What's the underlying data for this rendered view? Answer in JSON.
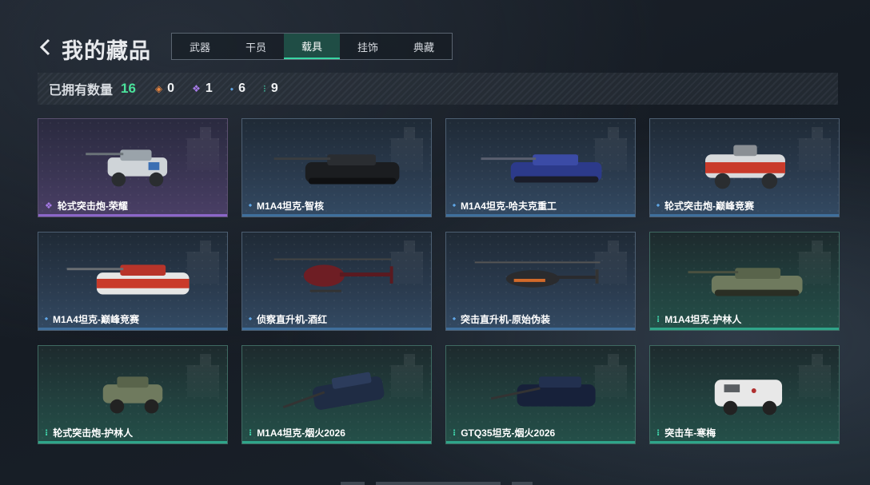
{
  "header": {
    "title": "我的藏品"
  },
  "tabs": [
    {
      "label": "武器",
      "active": false
    },
    {
      "label": "干员",
      "active": false
    },
    {
      "label": "载具",
      "active": true
    },
    {
      "label": "挂饰",
      "active": false
    },
    {
      "label": "典藏",
      "active": false
    }
  ],
  "stats": {
    "owned_label": "已拥有数量",
    "owned_total": "16",
    "orange_count": "0",
    "purple_count": "1",
    "blue_count": "6",
    "green_count": "9"
  },
  "colors": {
    "accent_green": "#4be39c",
    "rarity_orange": "#e9853f",
    "rarity_purple": "#a77be8",
    "rarity_blue": "#5fa6e6",
    "rarity_green": "#3fd0a8"
  },
  "items": [
    {
      "name": "轮式突击炮-荣耀",
      "rarity": "purple"
    },
    {
      "name": "M1A4坦克-智核",
      "rarity": "blue"
    },
    {
      "name": "M1A4坦克-哈夫克重工",
      "rarity": "blue"
    },
    {
      "name": "轮式突击炮-巅峰竞赛",
      "rarity": "blue"
    },
    {
      "name": "M1A4坦克-巅峰竞赛",
      "rarity": "blue"
    },
    {
      "name": "侦察直升机-酒红",
      "rarity": "blue"
    },
    {
      "name": "突击直升机-原始伪装",
      "rarity": "blue"
    },
    {
      "name": "M1A4坦克-护林人",
      "rarity": "green"
    },
    {
      "name": "轮式突击炮-护林人",
      "rarity": "green"
    },
    {
      "name": "M1A4坦克-烟火2026",
      "rarity": "green"
    },
    {
      "name": "GTQ35坦克-烟火2026",
      "rarity": "green"
    },
    {
      "name": "突击车-寒梅",
      "rarity": "green"
    }
  ]
}
